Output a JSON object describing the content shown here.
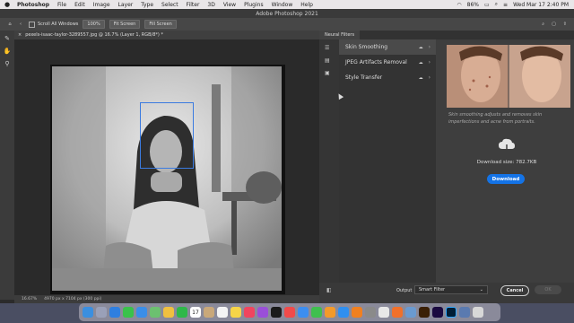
{
  "menubar": {
    "app": "Photoshop",
    "items": [
      "File",
      "Edit",
      "Image",
      "Layer",
      "Type",
      "Select",
      "Filter",
      "3D",
      "View",
      "Plugins",
      "Window",
      "Help"
    ],
    "battery": "86%",
    "datetime": "Wed Mar 17  2:40 PM"
  },
  "title": "Adobe Photoshop 2021",
  "options": {
    "scroll_all": "Scroll All Windows",
    "zoom": "100%",
    "fit": "Fit Screen",
    "fill": "Fill Screen"
  },
  "document": {
    "tab": "pexels-isaac-taylor-3289557.jpg @ 16.7% (Layer 1, RGB/8*) *",
    "zoom": "16.67%",
    "size": "4970 px x 7104 px (300 ppi)"
  },
  "neural": {
    "panel_title": "Neural Filters",
    "filters": [
      {
        "label": "Skin Smoothing"
      },
      {
        "label": "JPEG Artifacts Removal"
      },
      {
        "label": "Style Transfer"
      }
    ],
    "description": "Skin smoothing adjusts and removes skin imperfections and acne from portraits.",
    "download_size": "Download size: 782.7KB",
    "download_label": "Download",
    "output_label": "Output",
    "output_value": "Smart Filter",
    "cancel_label": "Cancel",
    "ok_label": "OK"
  },
  "dock": {
    "calendar_date": "17"
  }
}
